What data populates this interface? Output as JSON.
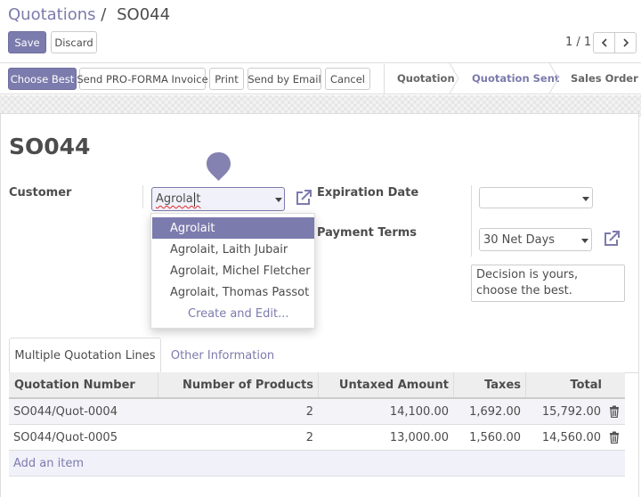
{
  "breadcrumb": {
    "parent": "Quotations",
    "separator": "/",
    "current": "SO044"
  },
  "buttons": {
    "save": "Save",
    "discard": "Discard"
  },
  "pager": {
    "value": "1 / 1",
    "prev_icon": "chevron-left-icon",
    "next_icon": "chevron-right-icon"
  },
  "actions": {
    "choose_best": "Choose Best",
    "pro_forma": "Send PRO-FORMA Invoice",
    "print": "Print",
    "send_email": "Send by Email",
    "cancel": "Cancel"
  },
  "stages": [
    {
      "label": "Quotation",
      "active": false
    },
    {
      "label": "Quotation Sent",
      "active": true
    },
    {
      "label": "Sales Order",
      "active": false
    }
  ],
  "form": {
    "title": "SO044",
    "customer_label": "Customer",
    "customer_value": "Agrolait",
    "expiration_label": "Expiration Date",
    "expiration_value": "",
    "payment_terms_label": "Payment Terms",
    "payment_terms_value": "30 Net Days",
    "note": "Decision is yours, choose the best."
  },
  "dropdown": {
    "items": [
      "Agrolait",
      "Agrolait, Laith Jubair",
      "Agrolait, Michel Fletcher",
      "Agrolait, Thomas Passot"
    ],
    "create": "Create and Edit..."
  },
  "tabs": [
    "Multiple Quotation Lines",
    "Other Information"
  ],
  "table": {
    "columns": [
      "Quotation Number",
      "Number of Products",
      "Untaxed Amount",
      "Taxes",
      "Total"
    ],
    "rows": [
      [
        "SO044/Quot-0004",
        "2",
        "14,100.00",
        "1,692.00",
        "15,792.00"
      ],
      [
        "SO044/Quot-0005",
        "2",
        "13,000.00",
        "1,560.00",
        "14,560.00"
      ]
    ],
    "add_item": "Add an item"
  },
  "colors": {
    "accent": "#7c7bad",
    "text": "#4c4c4c",
    "border": "#dddddd"
  }
}
